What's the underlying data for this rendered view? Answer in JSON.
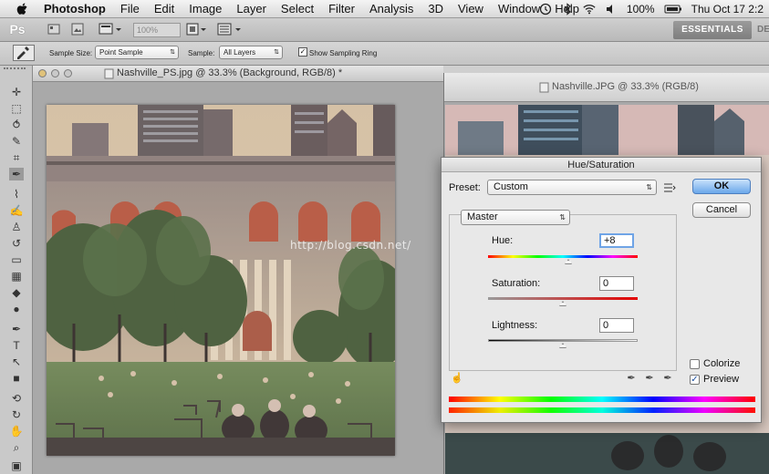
{
  "menubar": {
    "app": "Photoshop",
    "items": [
      "File",
      "Edit",
      "Image",
      "Layer",
      "Select",
      "Filter",
      "Analysis",
      "3D",
      "View",
      "Window",
      "Help"
    ],
    "battery": "100%",
    "clock": "Thu Oct 17  2:2"
  },
  "appbar": {
    "logo": "Ps",
    "zoom": "100%",
    "workspace": "ESSENTIALS",
    "workspace_next": "DESI"
  },
  "options": {
    "sample_size_label": "Sample Size:",
    "sample_size_value": "Point Sample",
    "sample_label": "Sample:",
    "sample_value": "All Layers",
    "show_ring_label": "Show Sampling Ring",
    "show_ring_checked": true
  },
  "doc1": {
    "title": "Nashville_PS.jpg @ 33.3% (Background, RGB/8) *"
  },
  "doc2": {
    "title": "Nashville.JPG @ 33.3% (RGB/8)"
  },
  "dialog": {
    "title": "Hue/Saturation",
    "preset_label": "Preset:",
    "preset_value": "Custom",
    "ok_label": "OK",
    "cancel_label": "Cancel",
    "channel_value": "Master",
    "hue_label": "Hue:",
    "hue_value": "+8",
    "saturation_label": "Saturation:",
    "saturation_value": "0",
    "lightness_label": "Lightness:",
    "lightness_value": "0",
    "colorize_label": "Colorize",
    "colorize_checked": false,
    "preview_label": "Preview",
    "preview_checked": true
  },
  "watermark": "http://blog.csdn.net/"
}
